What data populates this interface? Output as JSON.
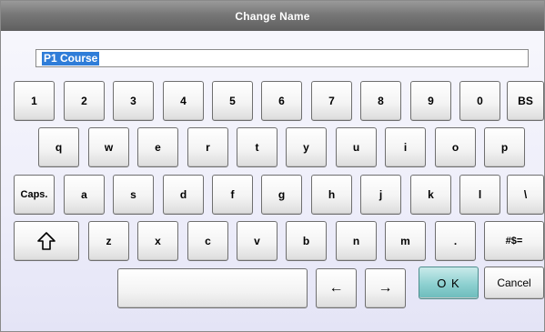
{
  "dialog": {
    "title": "Change Name",
    "name_value": "P1 Course"
  },
  "keyboard": {
    "row1": [
      "1",
      "2",
      "3",
      "4",
      "5",
      "6",
      "7",
      "8",
      "9",
      "0",
      "BS"
    ],
    "row2": [
      "q",
      "w",
      "e",
      "r",
      "t",
      "y",
      "u",
      "i",
      "o",
      "p"
    ],
    "row3": [
      "Caps.",
      "a",
      "s",
      "d",
      "f",
      "g",
      "h",
      "j",
      "k",
      "l",
      "\\"
    ],
    "row4": [
      "z",
      "x",
      "c",
      "v",
      "b",
      "n",
      "m",
      ".",
      "#$="
    ],
    "shift_icon": "shift-arrow-icon",
    "left_arrow": "←",
    "right_arrow": "→"
  },
  "actions": {
    "ok_label": "O K",
    "cancel_label": "Cancel"
  },
  "colors": {
    "title_bar": "#777777",
    "selection": "#2f7dd8",
    "ok_button": "#8dd0d0"
  }
}
